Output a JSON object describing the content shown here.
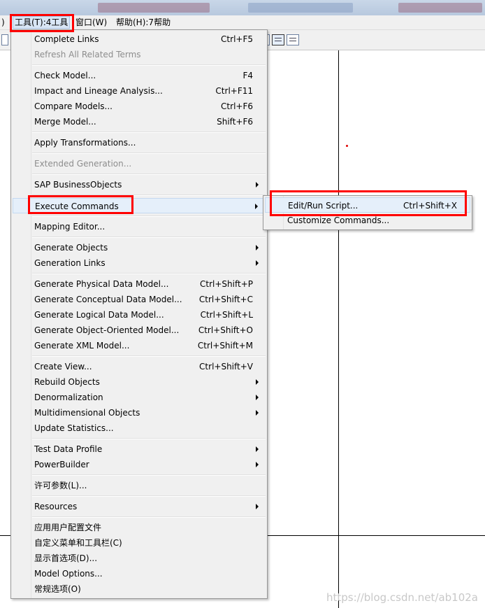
{
  "menubar": {
    "items": [
      {
        "label": ")"
      },
      {
        "label": "工具(T):4工具"
      },
      {
        "label": "窗口(W)"
      },
      {
        "label": "帮助(H):7帮助"
      }
    ]
  },
  "menu": {
    "items": [
      {
        "label": "Complete Links",
        "shortcut": "Ctrl+F5"
      },
      {
        "label": "Refresh All Related Terms",
        "shortcut": ""
      },
      {
        "label": "Check Model...",
        "shortcut": "F4"
      },
      {
        "label": "Impact and Lineage Analysis...",
        "shortcut": "Ctrl+F11"
      },
      {
        "label": "Compare Models...",
        "shortcut": "Ctrl+F6"
      },
      {
        "label": "Merge Model...",
        "shortcut": "Shift+F6"
      },
      {
        "label": "Apply Transformations...",
        "shortcut": ""
      },
      {
        "label": "Extended Generation...",
        "shortcut": ""
      },
      {
        "label": "SAP BusinessObjects",
        "shortcut": ""
      },
      {
        "label": "Execute Commands",
        "shortcut": ""
      },
      {
        "label": "Mapping Editor...",
        "shortcut": ""
      },
      {
        "label": "Generate Objects",
        "shortcut": ""
      },
      {
        "label": "Generation Links",
        "shortcut": ""
      },
      {
        "label": "Generate Physical Data Model...",
        "shortcut": "Ctrl+Shift+P"
      },
      {
        "label": "Generate Conceptual Data Model...",
        "shortcut": "Ctrl+Shift+C"
      },
      {
        "label": "Generate Logical Data Model...",
        "shortcut": "Ctrl+Shift+L"
      },
      {
        "label": "Generate Object-Oriented Model...",
        "shortcut": "Ctrl+Shift+O"
      },
      {
        "label": "Generate XML Model...",
        "shortcut": "Ctrl+Shift+M"
      },
      {
        "label": "Create View...",
        "shortcut": "Ctrl+Shift+V"
      },
      {
        "label": "Rebuild Objects",
        "shortcut": ""
      },
      {
        "label": "Denormalization",
        "shortcut": ""
      },
      {
        "label": "Multidimensional Objects",
        "shortcut": ""
      },
      {
        "label": "Update Statistics...",
        "shortcut": ""
      },
      {
        "label": "Test Data Profile",
        "shortcut": ""
      },
      {
        "label": "PowerBuilder",
        "shortcut": ""
      },
      {
        "label": "许可参数(L)...",
        "shortcut": ""
      },
      {
        "label": "Resources",
        "shortcut": ""
      },
      {
        "label": "应用用户配置文件",
        "shortcut": ""
      },
      {
        "label": "自定义菜单和工具栏(C)",
        "shortcut": ""
      },
      {
        "label": "显示首选项(D)...",
        "shortcut": ""
      },
      {
        "label": "Model Options...",
        "shortcut": ""
      },
      {
        "label": "常规选项(O)",
        "shortcut": ""
      }
    ]
  },
  "submenu": {
    "items": [
      {
        "label": "Edit/Run Script...",
        "shortcut": "Ctrl+Shift+X"
      },
      {
        "label": "Customize Commands...",
        "shortcut": ""
      }
    ]
  },
  "watermark": "https://blog.csdn.net/ab102a",
  "colors": {
    "annotation_red": "#ff0000",
    "menu_bg": "#f0f0f0",
    "highlight_bg": "#e5effa"
  }
}
